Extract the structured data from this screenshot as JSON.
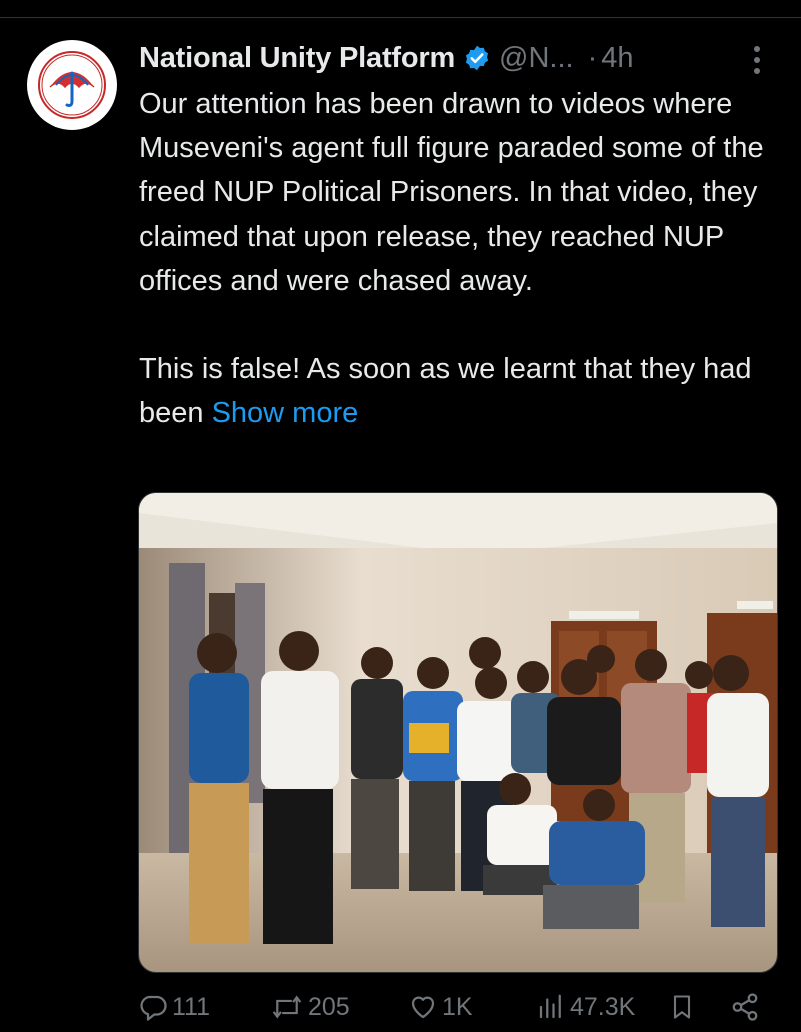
{
  "tweet": {
    "author": {
      "display_name": "National Unity Platform",
      "handle": "@N...",
      "verified": true,
      "avatar_icon": "nup-umbrella-logo"
    },
    "dot": "·",
    "time": "4h",
    "text_paragraph_1": "Our attention has been drawn to videos where Museveni's agent full figure paraded some of the freed NUP Political Prisoners. In that video, they claimed that upon release, they reached NUP offices and were chased away.",
    "text_paragraph_2_prefix": "This is false! As soon as we learnt that they had been ",
    "show_more_label": "Show more",
    "media": {
      "description_icon": "group-photo"
    },
    "actions": {
      "replies": "111",
      "reposts": "205",
      "likes": "1K",
      "views": "47.3K"
    }
  },
  "colors": {
    "background": "#000000",
    "text": "#e7e9ea",
    "muted": "#71767b",
    "link": "#1d9bf0",
    "verified_badge": "#1d9bf0"
  }
}
